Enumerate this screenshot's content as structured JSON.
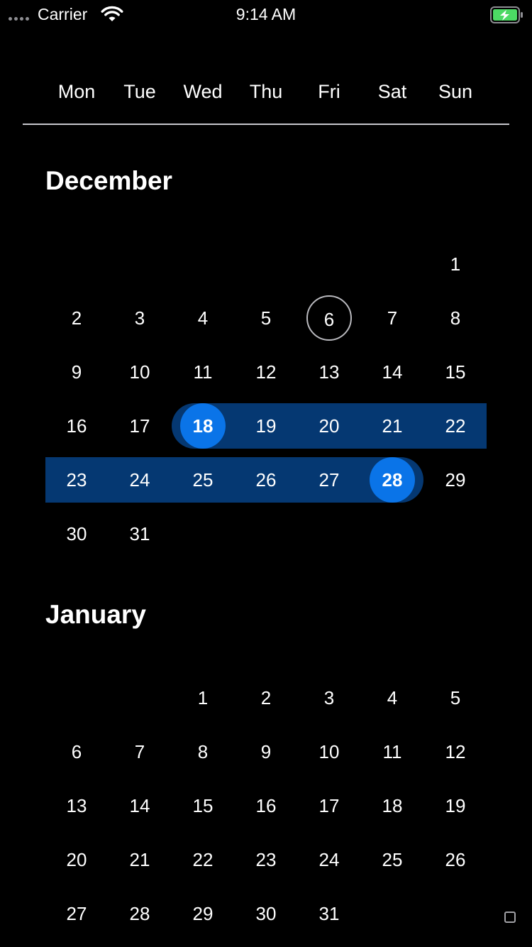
{
  "status_bar": {
    "carrier": "Carrier",
    "time": "9:14 AM",
    "battery_color": "#4cd964"
  },
  "weekdays": [
    "Mon",
    "Tue",
    "Wed",
    "Thu",
    "Fri",
    "Sat",
    "Sun"
  ],
  "colors": {
    "background": "#000000",
    "selection_endpoint": "#0a74e8",
    "selection_range": "#053872",
    "today_ring": "#b9b9be"
  },
  "months": [
    {
      "name": "December",
      "first_weekday_index": 6,
      "days": 31,
      "today": 6,
      "range_start": 18,
      "range_end": 28
    },
    {
      "name": "January",
      "first_weekday_index": 2,
      "days": 31
    }
  ]
}
